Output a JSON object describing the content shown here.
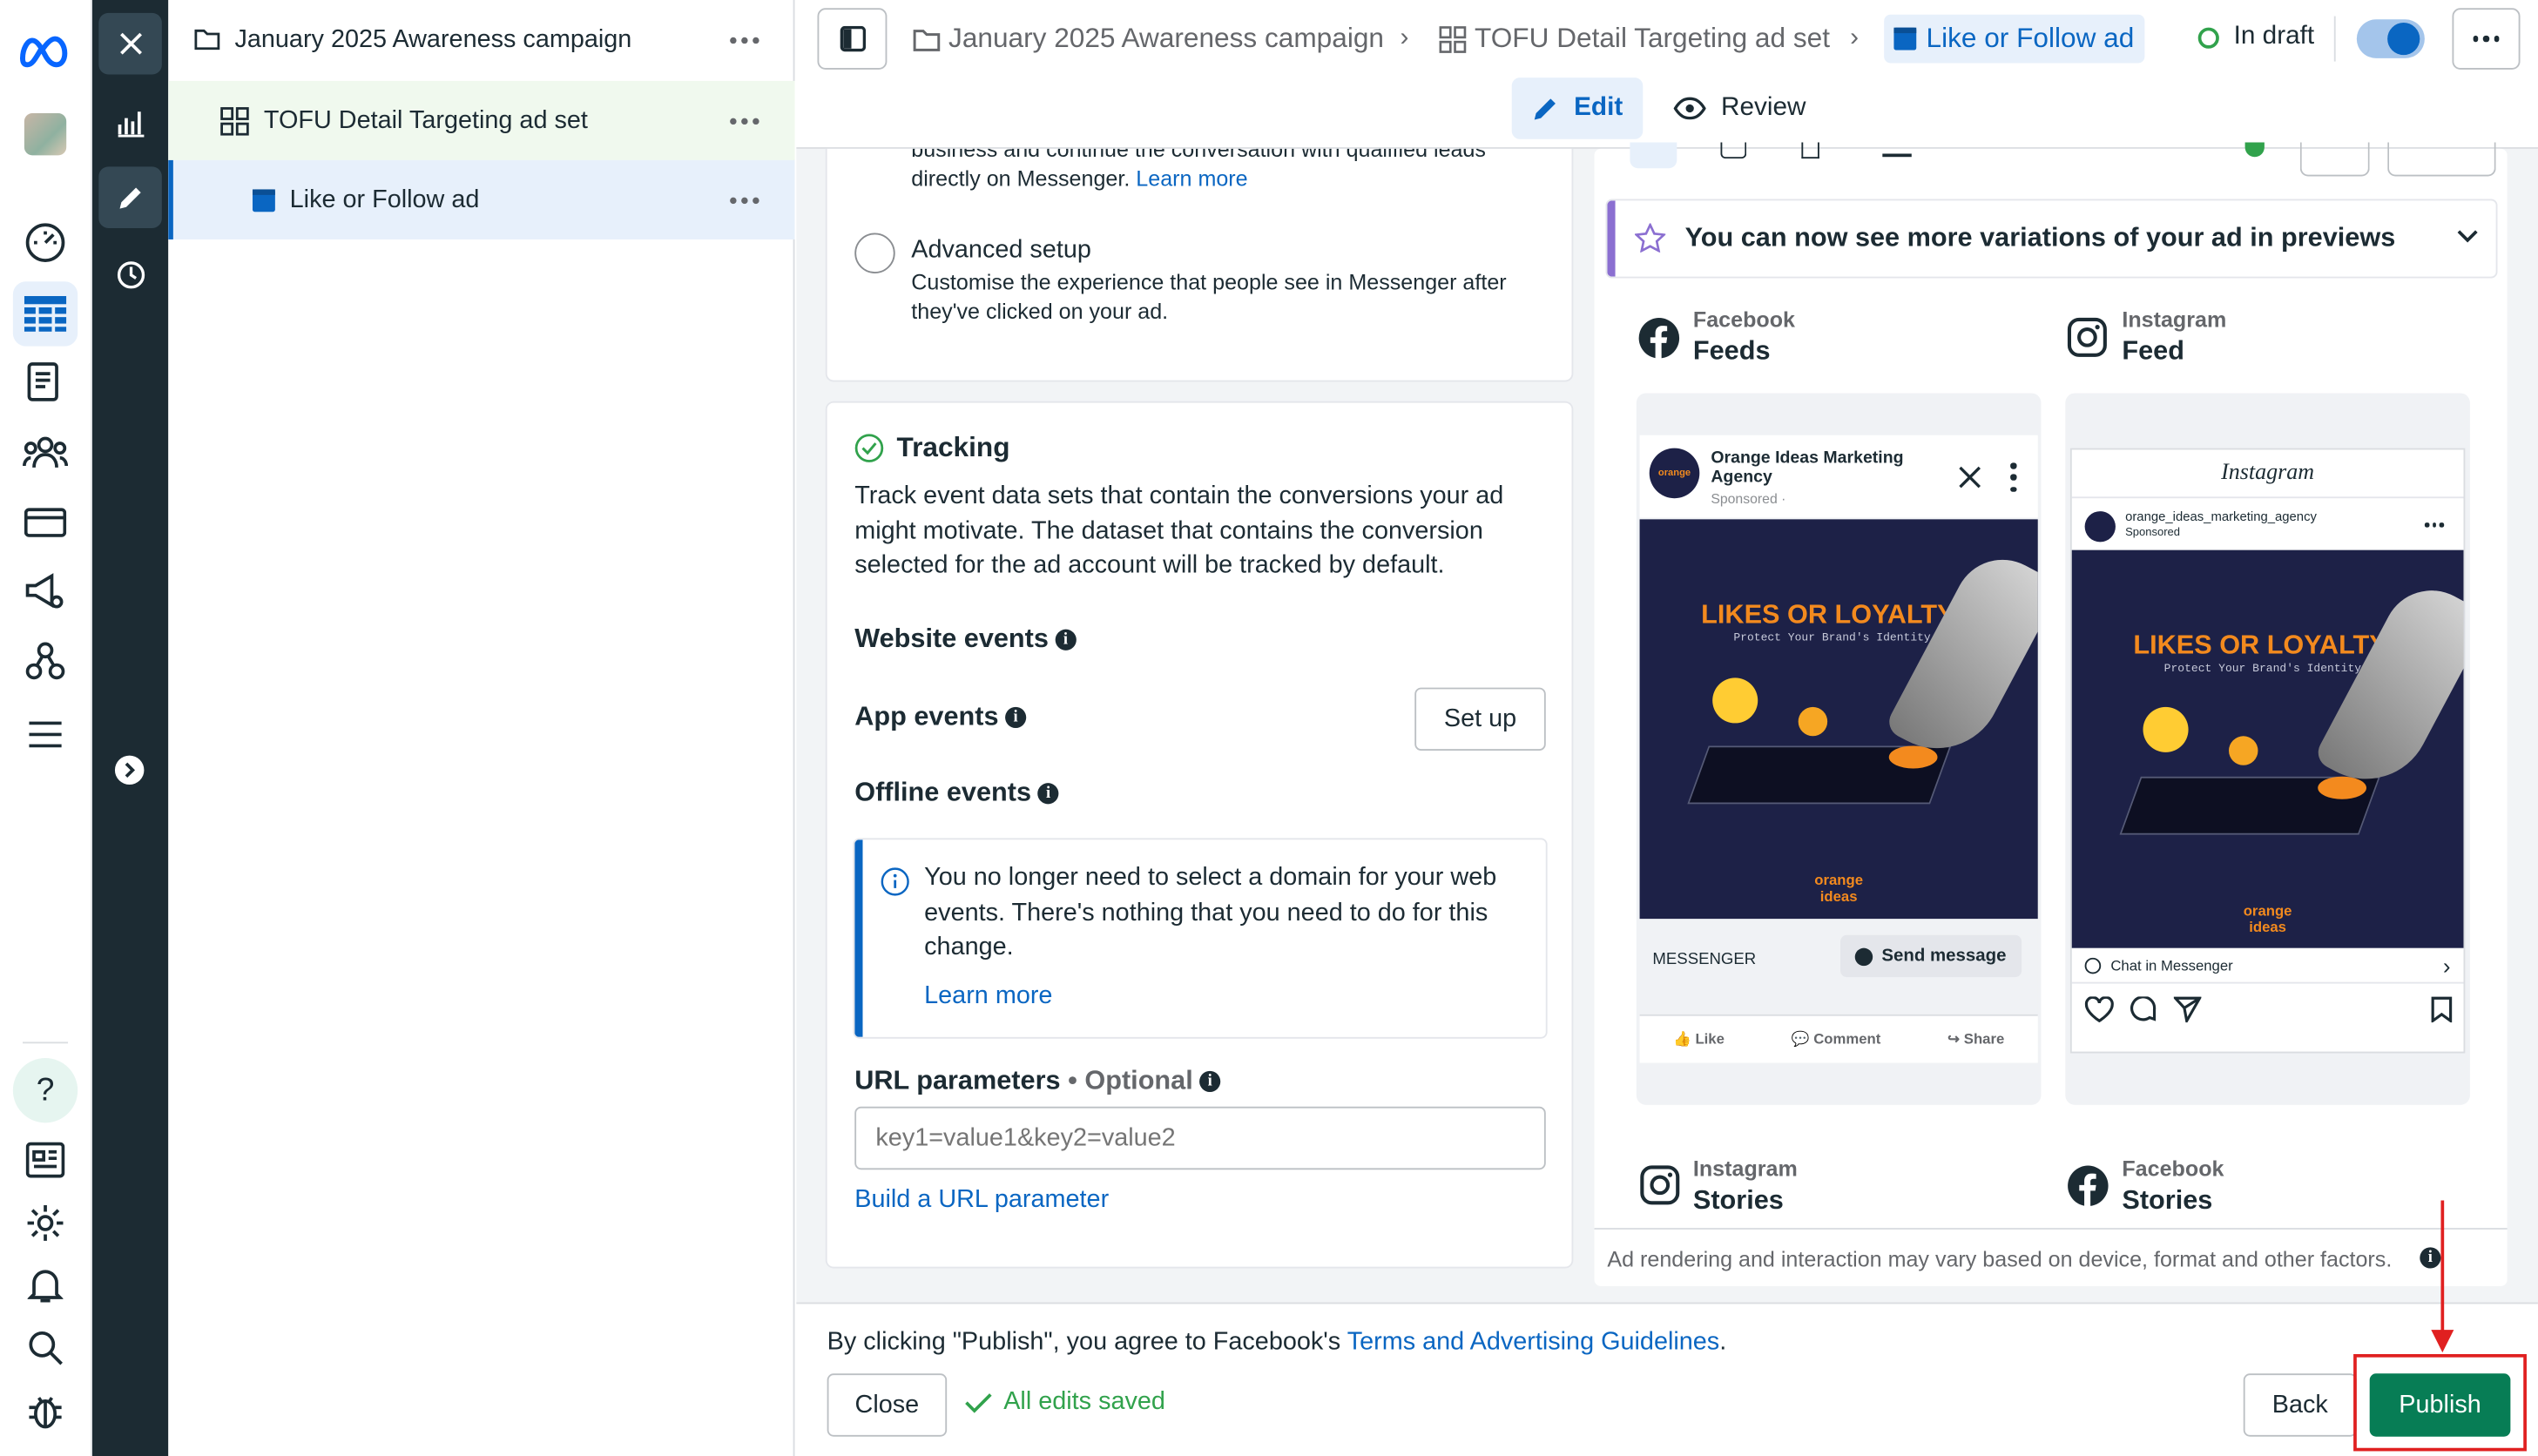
{
  "tree": {
    "campaign": "January 2025 Awareness campaign",
    "adset": "TOFU Detail Targeting ad set",
    "ad": "Like or Follow ad"
  },
  "breadcrumb": {
    "campaign": "January 2025 Awareness campaign",
    "adset": "TOFU Detail Targeting ad set",
    "ad": "Like or Follow ad",
    "status": "In draft"
  },
  "tabs": {
    "edit": "Edit",
    "review": "Review"
  },
  "messenger_setup": {
    "top_text_line1": "business and continue the conversation with qualified leads",
    "top_text_line2": "directly on Messenger.",
    "learn_more": "Learn more",
    "advanced_title": "Advanced setup",
    "advanced_desc": "Customise the experience that people see in Messenger after they've clicked on your ad."
  },
  "tracking": {
    "title": "Tracking",
    "description": "Track event data sets that contain the conversions your ad might motivate. The dataset that contains the conversion selected for the ad account will be tracked by default.",
    "website_events": "Website events",
    "app_events": "App events",
    "set_up": "Set up",
    "offline_events": "Offline events",
    "notice": "You no longer need to select a domain for your web events. There's nothing that you need to do for this change.",
    "notice_link": "Learn more",
    "url_params_label": "URL parameters",
    "optional": "Optional",
    "url_placeholder": "key1=value1&key2=value2",
    "build_link": "Build a URL parameter"
  },
  "preview": {
    "banner": "You can now see more variations of your ad in previews",
    "placements": [
      {
        "platform": "Facebook",
        "name": "Feeds"
      },
      {
        "platform": "Instagram",
        "name": "Feed"
      },
      {
        "platform": "Instagram",
        "name": "Stories"
      },
      {
        "platform": "Facebook",
        "name": "Stories"
      }
    ],
    "fb_post": {
      "page_name": "Orange Ideas Marketing Agency",
      "sponsored": "Sponsored ·",
      "headline": "LIKES OR LOYALTY?",
      "tagline": "Protect Your Brand's Identity",
      "brand": "orange ideas",
      "cta_label": "MESSENGER",
      "cta_button": "Send message",
      "like": "Like",
      "comment": "Comment",
      "share": "Share"
    },
    "ig_post": {
      "logo": "Instagram",
      "account": "orange_ideas_marketing_agency",
      "sponsored": "Sponsored",
      "headline": "LIKES OR LOYALTY?",
      "tagline": "Protect Your Brand's Identity",
      "brand": "orange ideas",
      "cta": "Chat in Messenger"
    },
    "disclaimer": "Ad rendering and interaction may vary based on device, format and other factors."
  },
  "footer": {
    "agree_text": "By clicking \"Publish\", you agree to Facebook's",
    "terms_link": "Terms and Advertising Guidelines",
    "period": ".",
    "close": "Close",
    "saved": "All edits saved",
    "back": "Back",
    "publish": "Publish"
  },
  "colors": {
    "accent": "#0a66c2",
    "publish": "#077d55",
    "highlight": "#e02020"
  }
}
